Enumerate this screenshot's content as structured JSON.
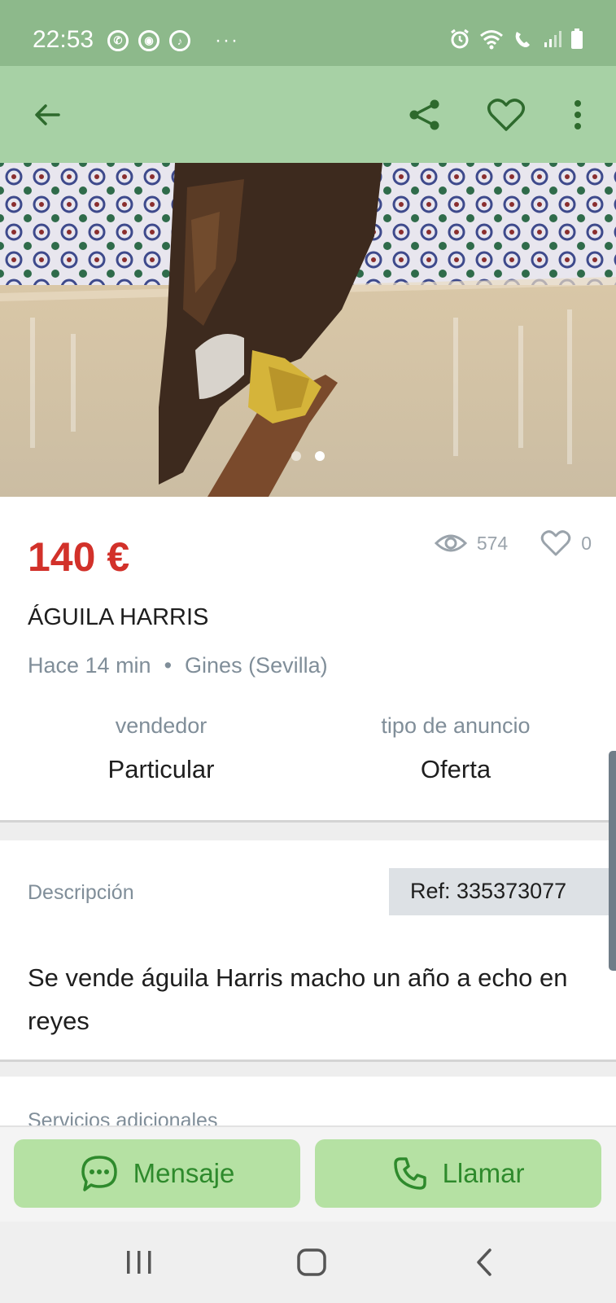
{
  "status_bar": {
    "time": "22:53",
    "app_icons": [
      "whatsapp-icon",
      "chrome-icon",
      "music-icon"
    ],
    "more": "···",
    "right_icons": [
      "alarm-icon",
      "wifi-icon",
      "wifi-call-icon",
      "signal-icon",
      "battery-icon"
    ]
  },
  "app_bar": {
    "back": "arrow-left-icon",
    "actions": [
      "share-icon",
      "heart-icon",
      "more-vert-icon"
    ]
  },
  "gallery": {
    "image": "harris-eagle-photo",
    "page_count": 2,
    "current_page": 2
  },
  "listing": {
    "price": "140 €",
    "views": "574",
    "favorites": "0",
    "title": "ÁGUILA HARRIS",
    "posted": "Hace 14 min",
    "separator": "•",
    "location": "Gines (Sevilla)",
    "seller_label": "vendedor",
    "seller_value": "Particular",
    "type_label": "tipo de anuncio",
    "type_value": "Oferta"
  },
  "description": {
    "label": "Descripción",
    "ref": "Ref: 335373077",
    "text": "Se vende águila Harris macho un año a echo en reyes"
  },
  "extras": {
    "label": "Servicios adicionales"
  },
  "actions": {
    "message_label": "Mensaje",
    "call_label": "Llamar"
  },
  "colors": {
    "status_bar": "#8db98b",
    "app_bar": "#a7d1a5",
    "price": "#d2312a",
    "button_bg": "#b5e1a3",
    "button_fg": "#2e8a2c"
  }
}
